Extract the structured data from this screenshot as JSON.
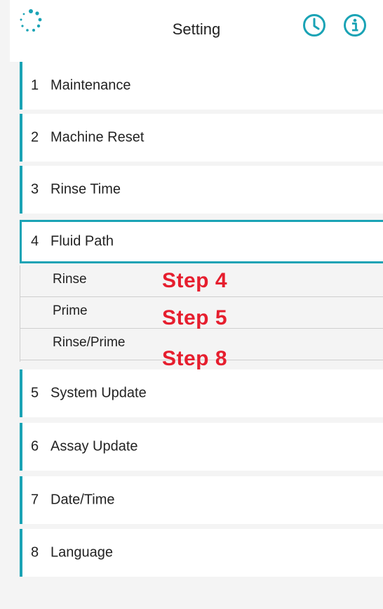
{
  "header": {
    "title": "Setting",
    "logo_icon": "loading-spinner-icon",
    "clock_icon": "clock-icon",
    "info_icon": "info-icon",
    "accent": "#1aa3b5"
  },
  "menu": [
    {
      "num": "1",
      "label": "Maintenance"
    },
    {
      "num": "2",
      "label": "Machine Reset"
    },
    {
      "num": "3",
      "label": "Rinse Time"
    },
    {
      "num": "4",
      "label": "Fluid Path",
      "selected": true
    },
    {
      "num": "5",
      "label": "System Update"
    },
    {
      "num": "6",
      "label": "Assay Update"
    },
    {
      "num": "7",
      "label": "Date/Time"
    },
    {
      "num": "8",
      "label": "Language"
    }
  ],
  "submenu": [
    {
      "label": "Rinse"
    },
    {
      "label": "Prime"
    },
    {
      "label": "Rinse/Prime"
    }
  ],
  "annotations": [
    {
      "text": "Step 4",
      "color": "#e61e2e"
    },
    {
      "text": "Step 5",
      "color": "#e61e2e"
    },
    {
      "text": "Step 8",
      "color": "#e61e2e"
    }
  ]
}
